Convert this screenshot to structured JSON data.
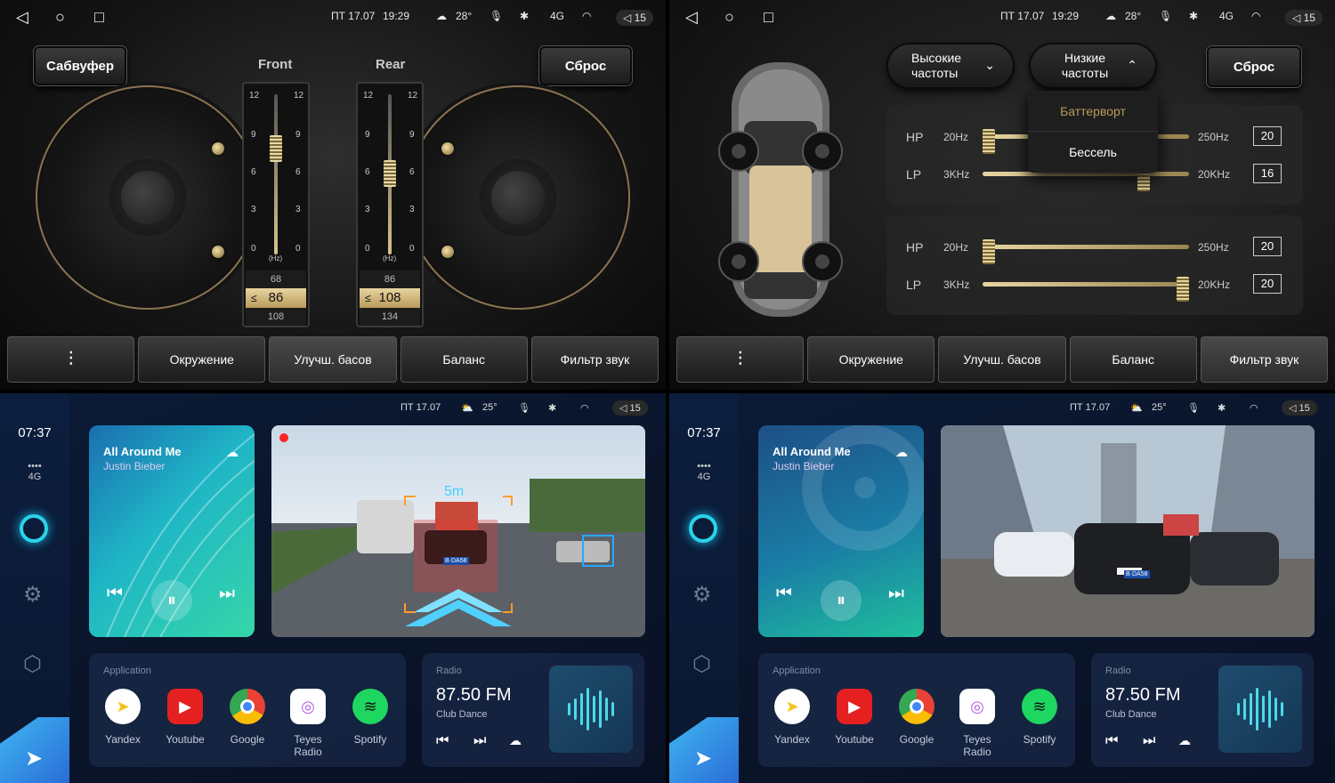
{
  "status_dark": {
    "date": "ПТ 17.07",
    "time": "19:29",
    "temp": "28°",
    "net": "4G",
    "volume": "15"
  },
  "status_blue": {
    "date": "ПТ 17.07",
    "temp": "25°",
    "volume": "15"
  },
  "q1": {
    "subwoofer_btn": "Сабвуфер",
    "reset_btn": "Сброс",
    "front_label": "Front",
    "rear_label": "Rear",
    "scale": [
      "12",
      "9",
      "6",
      "3",
      "0"
    ],
    "hz_unit": "(Hz)",
    "front": {
      "prev": "68",
      "current": "86",
      "next": "108",
      "level": 0.72
    },
    "rear": {
      "prev": "86",
      "current": "108",
      "next": "134",
      "level": 0.55
    }
  },
  "q2": {
    "high_dd": "Высокие частоты",
    "low_dd": "Низкие частоты",
    "reset_btn": "Сброс",
    "popup": [
      "Баттерворт",
      "Бессель"
    ],
    "panel1": {
      "hp": {
        "key": "HP",
        "lo": "20Hz",
        "hi": "250Hz",
        "val": "20",
        "level": 0.0
      },
      "lp": {
        "key": "LP",
        "lo": "3KHz",
        "hi": "20KHz",
        "val": "16",
        "level": 0.8
      }
    },
    "panel2": {
      "hp": {
        "key": "HP",
        "lo": "20Hz",
        "hi": "250Hz",
        "val": "20",
        "level": 0.0
      },
      "lp": {
        "key": "LP",
        "lo": "3KHz",
        "hi": "20KHz",
        "val": "20",
        "level": 1.0
      }
    }
  },
  "tabs": {
    "q1": [
      "Окружение",
      "Улучш. басов",
      "Баланс",
      "Фильтр звук"
    ],
    "q2": [
      "Окружение",
      "Улучш. басов",
      "Баланс",
      "Фильтр звук"
    ]
  },
  "home": {
    "clock": "07:37",
    "net": "4G",
    "song": "All Around Me",
    "artist": "Justin Bieber",
    "distance": "5m",
    "plate": "B·DA58",
    "apps_header": "Application",
    "apps": [
      "Yandex",
      "Youtube",
      "Google",
      "Teyes Radio",
      "Spotify"
    ],
    "radio_header": "Radio",
    "freq": "87.50 FM",
    "station": "Club Dance"
  },
  "colors": {
    "gold": "#d8c38a",
    "accent_cyan": "#2ad4e8",
    "bg_blue": "#0a1428"
  }
}
